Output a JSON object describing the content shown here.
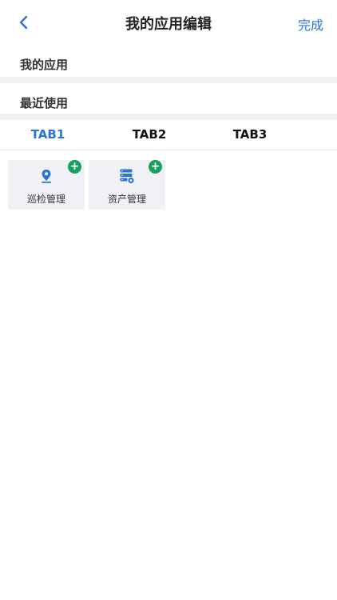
{
  "header": {
    "title": "我的应用编辑",
    "back_icon": "chevron-left-icon",
    "done_label": "完成",
    "accent_color": "#2b73d6"
  },
  "sections": {
    "my_apps_title": "我的应用",
    "recent_title": "最近使用"
  },
  "tabs": [
    {
      "label": "TAB1",
      "active": true
    },
    {
      "label": "TAB2",
      "active": false
    },
    {
      "label": "TAB3",
      "active": false
    }
  ],
  "apps": [
    {
      "label": "巡检管理",
      "icon": "location-pin-icon",
      "badge": "+"
    },
    {
      "label": "资产管理",
      "icon": "server-settings-icon",
      "badge": "+"
    }
  ],
  "badge_color": "#17a061"
}
